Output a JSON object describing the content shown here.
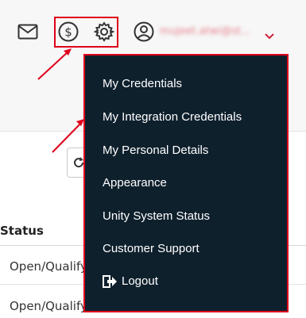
{
  "header": {
    "username": "mujeet.atwi@st...",
    "icons": [
      "mail-icon",
      "dollar-icon",
      "gear-icon",
      "user-icon",
      "chevron-down-icon"
    ]
  },
  "table": {
    "header_status": "Status",
    "rows": [
      {
        "status": "Open/Qualify"
      },
      {
        "status": "Open/Qualify"
      }
    ]
  },
  "menu": {
    "items": [
      {
        "label": "My Credentials"
      },
      {
        "label": "My Integration Credentials"
      },
      {
        "label": "My Personal Details"
      },
      {
        "label": "Appearance"
      },
      {
        "label": "Unity System Status"
      },
      {
        "label": "Customer Support"
      },
      {
        "label": "Logout",
        "icon": "logout-icon"
      }
    ]
  },
  "colors": {
    "menu_bg": "#0f202d",
    "highlight": "#e0001b",
    "username": "#e7808a"
  }
}
